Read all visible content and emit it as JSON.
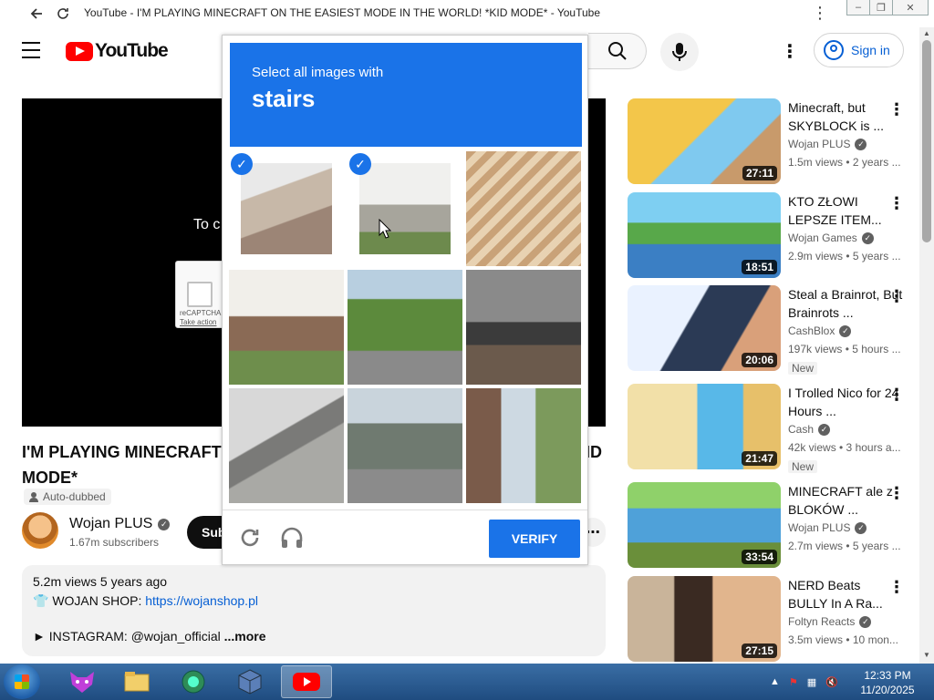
{
  "window": {
    "title": "YouTube - I'M PLAYING MINECRAFT ON THE EASIEST MODE IN THE WORLD! *KID MODE* - YouTube"
  },
  "header": {
    "logo_text": "YouTube",
    "signin_label": "Sign in"
  },
  "player": {
    "message": "To c",
    "recaptcha_label": "reCAPTCHA",
    "recaptcha_link": "Take action"
  },
  "video": {
    "title_line1": "I'M PLAYING MINECRAFT",
    "title_tail": "ID",
    "title_line2": "MODE*",
    "auto_dubbed": "Auto-dubbed",
    "channel": "Wojan PLUS",
    "subscribers": "1.67m subscribers",
    "subscribe_label": "Sub",
    "description": {
      "stats": "5.2m views  5 years ago",
      "shop_prefix": "👕 WOJAN SHOP: ",
      "shop_link": "https://wojanshop.pl",
      "instagram": "► INSTAGRAM: @wojan_official",
      "more": "...more"
    }
  },
  "captcha": {
    "instruction": "Select all images with",
    "target": "stairs",
    "verify_label": "VERIFY",
    "tiles": [
      {
        "selected": true
      },
      {
        "selected": true
      },
      {
        "selected": false
      },
      {
        "selected": false
      },
      {
        "selected": false
      },
      {
        "selected": false
      },
      {
        "selected": false
      },
      {
        "selected": false
      },
      {
        "selected": false
      }
    ]
  },
  "recommendations": [
    {
      "title": "Minecraft, but SKYBLOCK is ...",
      "channel": "Wojan PLUS",
      "verified": true,
      "meta": "1.5m views • 2 years ...",
      "duration": "27:11",
      "new": false
    },
    {
      "title": "KTO ZŁOWI LEPSZE ITEM...",
      "channel": "Wojan Games",
      "verified": true,
      "meta": "2.9m views • 5 years ...",
      "duration": "18:51",
      "new": false
    },
    {
      "title": "Steal a Brainrot, But Brainrots ...",
      "channel": "CashBlox",
      "verified": true,
      "meta": "197k views • 5 hours ...",
      "duration": "20:06",
      "new": true
    },
    {
      "title": "I Trolled Nico for 24 Hours ...",
      "channel": "Cash",
      "verified": true,
      "meta": "42k views • 3 hours a...",
      "duration": "21:47",
      "new": true
    },
    {
      "title": "MINECRAFT ale z BLOKÓW ...",
      "channel": "Wojan PLUS",
      "verified": true,
      "meta": "2.7m views • 5 years ...",
      "duration": "33:54",
      "new": false
    },
    {
      "title": "NERD Beats BULLY In A Ra...",
      "channel": "Foltyn Reacts",
      "verified": true,
      "meta": "3.5m views • 10 mon...",
      "duration": "27:15",
      "new": false
    }
  ],
  "new_badge": "New",
  "taskbar": {
    "time": "12:33 PM",
    "date": "11/20/2025"
  },
  "colors": {
    "captcha_blue": "#1a73e8",
    "youtube_red": "#ff0000",
    "link_blue": "#065fd4"
  }
}
